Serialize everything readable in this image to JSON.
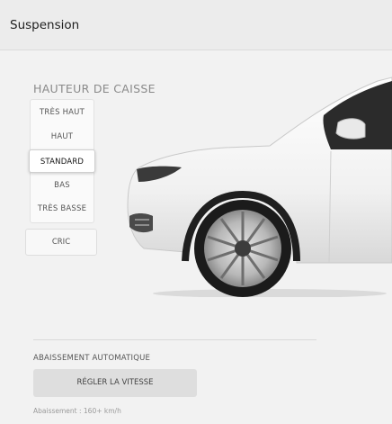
{
  "header": {
    "title": "Suspension"
  },
  "ride_height": {
    "label": "HAUTEUR DE CAISSE",
    "options": [
      "TRÈS HAUT",
      "HAUT",
      "STANDARD",
      "BAS",
      "TRÈS BASSE"
    ],
    "selected": "STANDARD"
  },
  "jack_button": {
    "label": "CRIC"
  },
  "auto_lowering": {
    "label": "ABAISSEMENT AUTOMATIQUE",
    "button_label": "RÉGLER LA VITESSE",
    "info": "Abaissement : 160+ km/h"
  },
  "car_image": {
    "description_icon": "car-front-wheel-image"
  }
}
